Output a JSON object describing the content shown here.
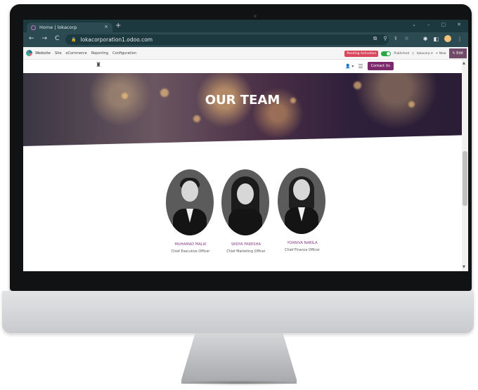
{
  "browser": {
    "tab_title": "Home | lokacorp",
    "tab_close": "×",
    "new_tab": "+",
    "url": "lokacorporation1.odoo.com",
    "window_controls": [
      "⌄",
      "–",
      "▢",
      "✕"
    ],
    "nav_icons": [
      "←",
      "→",
      "C"
    ]
  },
  "odoo_bar": {
    "brand": "Website",
    "menu": [
      "Site",
      "eCommerce",
      "Reporting",
      "Configuration"
    ],
    "pending_badge": "Pending Activation",
    "published_label": "Published",
    "company": "lokacorp ▾",
    "new_label": "+ New",
    "edit_label": "✎ Edit",
    "published": true
  },
  "site_header": {
    "contact_button": "Contact Us"
  },
  "hero": {
    "title": "OUR TEAM"
  },
  "team": [
    {
      "name": "MUHAMAD MALIK",
      "role": "Chief Executive Officer"
    },
    {
      "name": "WIDYA FARESHA",
      "role": "Chief Marketing Officer"
    },
    {
      "name": "YOANIVA NABILA",
      "role": "Chief Finance Officer"
    }
  ],
  "colors": {
    "browser_frame": "#1d3940",
    "odoo_primary": "#714b67",
    "contact_button": "#7c2a6d",
    "member_name": "#8e3f8a",
    "section_bg": "#f4f1ee"
  }
}
